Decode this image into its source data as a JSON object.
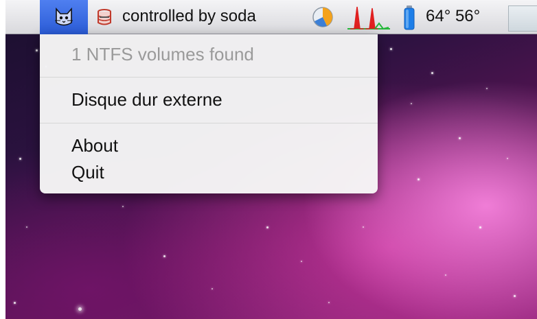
{
  "menubar": {
    "soda_status": "controlled by soda",
    "temperatures": "64° 56°",
    "icons": [
      "cat-app-icon",
      "soda-can-icon",
      "pie-progress-icon",
      "activity-graph-icon",
      "battery-icon",
      "monitor-box-icon"
    ]
  },
  "menu": {
    "header": "1 NTFS volumes found",
    "volume": "Disque dur externe",
    "about": "About",
    "quit": "Quit"
  },
  "colors": {
    "menubar_highlight": "#2a5bd6",
    "graph_red": "#e02020",
    "graph_green": "#25b83a",
    "battery_blue": "#1d7ee8",
    "pie_orange": "#f4a21c"
  }
}
